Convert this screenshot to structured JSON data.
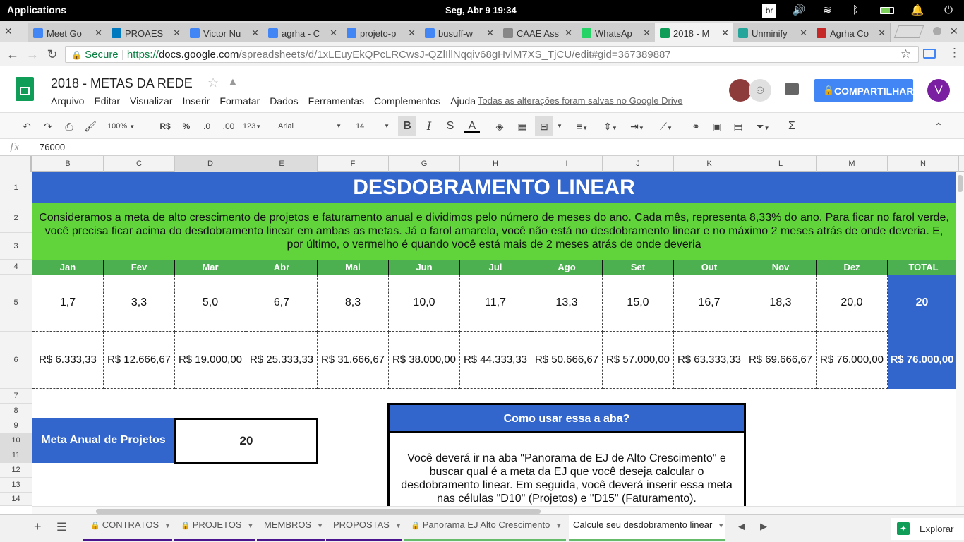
{
  "os": {
    "apps": "Applications",
    "clock": "Seg, Abr  9   19:34",
    "keyboard": "br"
  },
  "tabs": [
    {
      "label": "Meet Go",
      "icon": "google-icon",
      "color": "#4285f4"
    },
    {
      "label": "PROAES",
      "icon": "trello-icon",
      "color": "#0079bf"
    },
    {
      "label": "Victor Nu",
      "icon": "docs-icon",
      "color": "#4285f4"
    },
    {
      "label": "agrha - C",
      "icon": "docs-icon",
      "color": "#4285f4"
    },
    {
      "label": "projeto-p",
      "icon": "docs-icon",
      "color": "#4285f4"
    },
    {
      "label": "busuff-w",
      "icon": "docs-icon",
      "color": "#4285f4"
    },
    {
      "label": "CAAE Ass",
      "icon": "plataforma-icon",
      "color": "#888888"
    },
    {
      "label": "WhatsAp",
      "icon": "whatsapp-icon",
      "color": "#25d366"
    },
    {
      "label": "2018 - M",
      "icon": "sheets-icon",
      "color": "#0f9d58"
    },
    {
      "label": "Unminify",
      "icon": "unminify-icon",
      "color": "#26a69a"
    },
    {
      "label": "Agrha Co",
      "icon": "drive-icon",
      "color": "#c62828"
    }
  ],
  "address": {
    "secure": "Secure",
    "scheme": "https://",
    "domain": "docs.google.com",
    "path": "/spreadsheets/d/1xLEuyEkQPcLRCwsJ-QZlIllNqqiv68gHvlM7XS_TjCU/edit#gid=367389887"
  },
  "doc": {
    "title": "2018 - METAS DA REDE",
    "menu": [
      "Arquivo",
      "Editar",
      "Visualizar",
      "Inserir",
      "Formatar",
      "Dados",
      "Ferramentas",
      "Complementos",
      "Ajuda"
    ],
    "saved": "Todas as alterações foram salvas no Google Drive",
    "share": "COMPARTILHAR",
    "avatar": "V"
  },
  "toolbar": {
    "zoom": "100%",
    "currency": "R$",
    "percent": "%",
    "dec_less": ".0",
    "dec_more": ".00",
    "format": "123",
    "font": "Arial",
    "size": "14",
    "bold": "B",
    "italic": "I",
    "strike": "S",
    "textcolor": "A",
    "sum": "Σ"
  },
  "formula": {
    "fx": "fx",
    "value": "76000"
  },
  "columns": [
    "B",
    "C",
    "D",
    "E",
    "F",
    "G",
    "H",
    "I",
    "J",
    "K",
    "L",
    "M",
    "N"
  ],
  "rows": [
    "1",
    "2",
    "3",
    "4",
    "5",
    "6",
    "7",
    "8",
    "9",
    "10",
    "11",
    "12",
    "13",
    "14"
  ],
  "sheet": {
    "title": "DESDOBRAMENTO LINEAR",
    "intro": "Consideramos a meta de alto crescimento de projetos e faturamento anual e dividimos pelo número de meses do ano. Cada mês, representa 8,33% do ano. Para ficar no farol verde, você precisa ficar acima do desdobramento linear em ambas as metas. Já o farol amarelo, você não está no desdobramento linear e no máximo 2 meses atrás de onde deveria. E, por último, o vermelho é quando você está mais de 2 meses atrás de onde deveria",
    "months": [
      "Jan",
      "Fev",
      "Mar",
      "Abr",
      "Mai",
      "Jun",
      "Jul",
      "Ago",
      "Set",
      "Out",
      "Nov",
      "Dez",
      "TOTAL"
    ],
    "projects": [
      "1,7",
      "3,3",
      "5,0",
      "6,7",
      "8,3",
      "10,0",
      "11,7",
      "13,3",
      "15,0",
      "16,7",
      "18,3",
      "20,0",
      "20"
    ],
    "revenue": [
      "R$ 6.333,33",
      "R$ 12.666,67",
      "R$ 19.000,00",
      "R$ 25.333,33",
      "R$ 31.666,67",
      "R$ 38.000,00",
      "R$ 44.333,33",
      "R$ 50.666,67",
      "R$ 57.000,00",
      "R$ 63.333,33",
      "R$ 69.666,67",
      "R$ 76.000,00",
      "R$ 76.000,00"
    ],
    "meta_label": "Meta Anual de Projetos",
    "meta_value": "20",
    "howto_title": "Como usar essa a aba?",
    "howto_text": "Você deverá ir na aba \"Panorama de EJ de Alto Crescimento\" e buscar qual é a meta da EJ que você deseja calcular o desdobramento linear. Em seguida, você deverá inserir essa meta nas células \"D10\" (Projetos) e \"D15\" (Faturamento). Automaticamente, a planilha irá"
  },
  "sheettabs": [
    {
      "label": "CONTRATOS",
      "locked": true,
      "color": "#4a148c"
    },
    {
      "label": "PROJETOS",
      "locked": true,
      "color": "#4a148c"
    },
    {
      "label": "MEMBROS",
      "locked": false,
      "color": "#4a148c"
    },
    {
      "label": "PROPOSTAS",
      "locked": false,
      "color": "#4a148c"
    },
    {
      "label": "Panorama EJ Alto Crescimento",
      "locked": true,
      "color": "#66bb6a"
    },
    {
      "label": "Calcule seu desdobramento linear",
      "locked": false,
      "color": "#66bb6a"
    }
  ],
  "explore": "Explorar",
  "colors": {
    "blue": "#3366cc",
    "green": "#62d43b",
    "header_green": "#4caf50"
  }
}
